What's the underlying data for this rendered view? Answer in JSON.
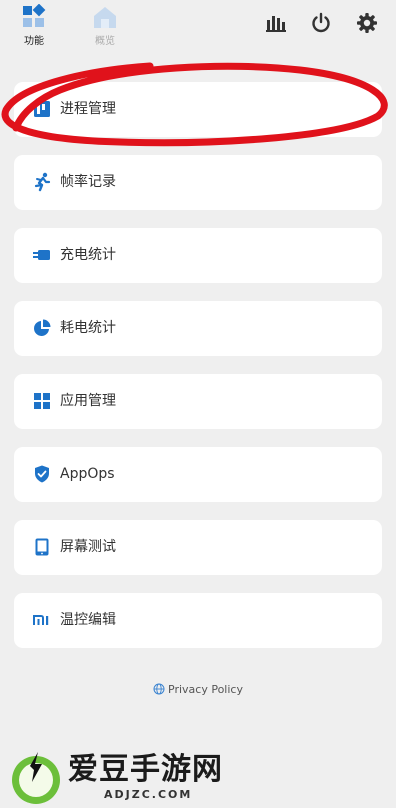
{
  "tabs": [
    {
      "label": "功能",
      "icon": "function-grid-icon",
      "active": true
    },
    {
      "label": "概览",
      "icon": "overview-home-icon",
      "active": false
    }
  ],
  "top_actions": [
    {
      "icon": "bar-chart-icon"
    },
    {
      "icon": "power-icon"
    },
    {
      "icon": "settings-gear-icon"
    }
  ],
  "menu": [
    {
      "label": "进程管理",
      "icon": "process-manager-icon"
    },
    {
      "label": "帧率记录",
      "icon": "running-person-icon"
    },
    {
      "label": "充电统计",
      "icon": "charging-plug-icon"
    },
    {
      "label": "耗电统计",
      "icon": "pie-chart-icon"
    },
    {
      "label": "应用管理",
      "icon": "app-grid-icon"
    },
    {
      "label": "AppOps",
      "icon": "shield-check-icon"
    },
    {
      "label": "屏幕测试",
      "icon": "tablet-screen-icon"
    },
    {
      "label": "温控编辑",
      "icon": "mi-logo-icon"
    }
  ],
  "footer": {
    "privacy_label": "Privacy Policy",
    "icon": "globe-icon"
  },
  "watermark": {
    "name": "爱豆手游网",
    "url": "ADJZC.COM"
  },
  "colors": {
    "accent": "#1e73c8",
    "background": "#efefef",
    "card": "#ffffff",
    "annotation": "#e0121b"
  }
}
